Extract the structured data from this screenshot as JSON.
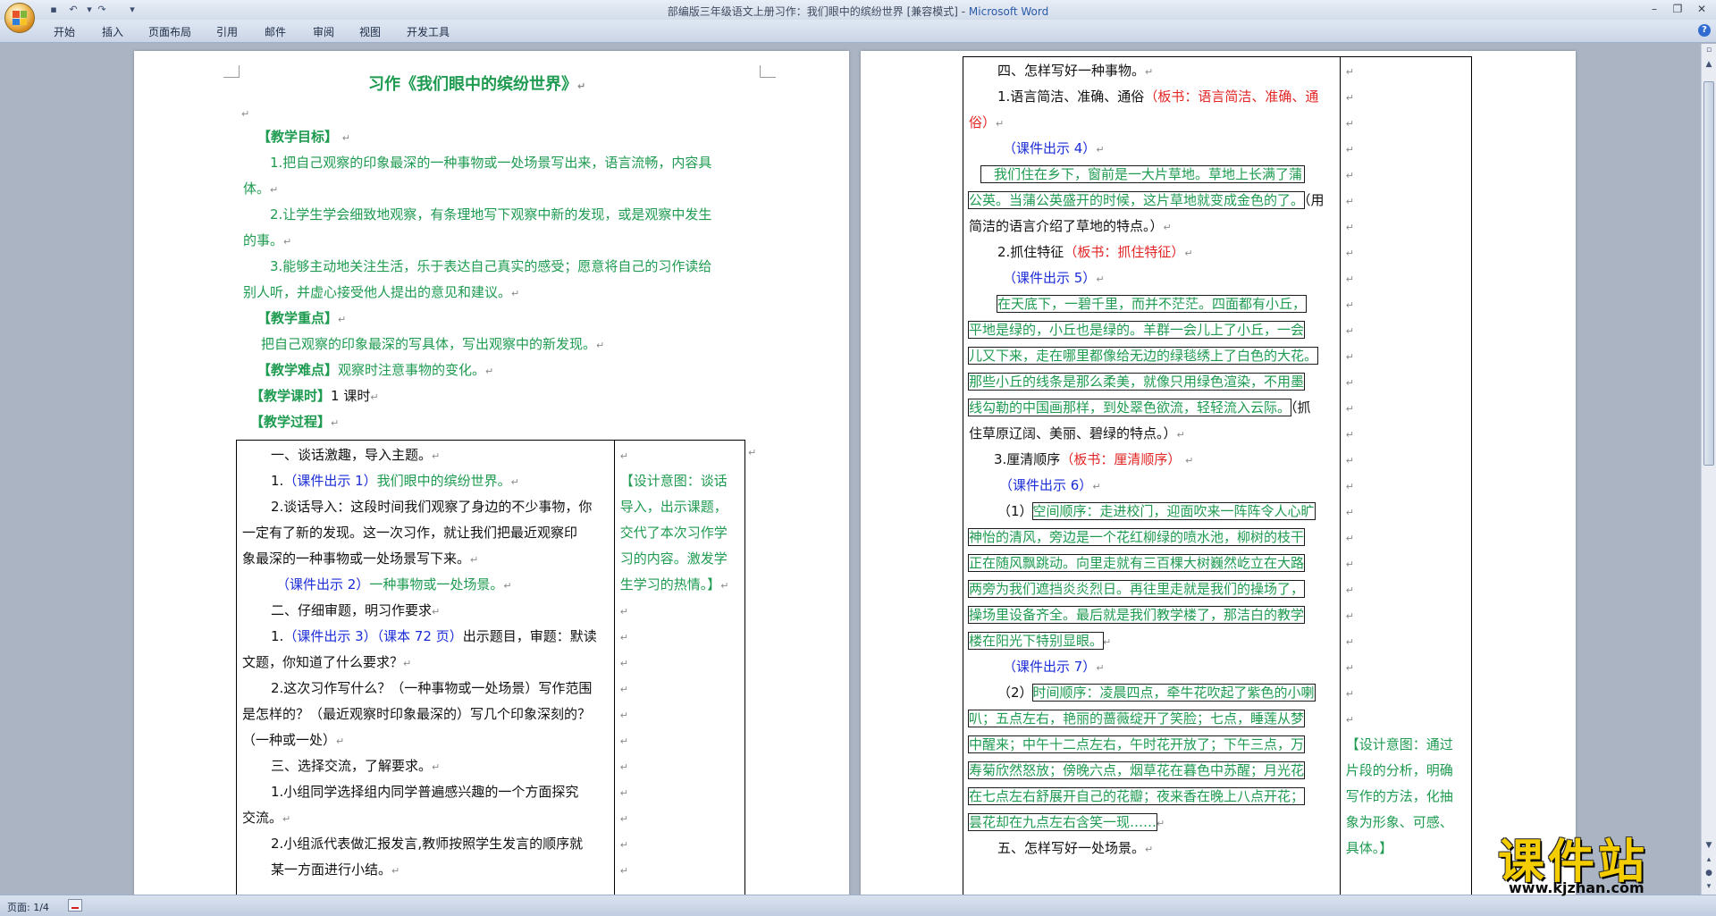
{
  "window": {
    "title": "部编版三年级语文上册习作：我们眼中的缤纷世界 [兼容模式] - ",
    "app_name": "Microsoft Word"
  },
  "quick_access": {
    "save_icon": "save-icon",
    "undo_icon": "undo-icon",
    "redo_icon": "redo-icon",
    "customize_icon": "customize-icon"
  },
  "ribbon": {
    "tabs": [
      "开始",
      "插入",
      "页面布局",
      "引用",
      "邮件",
      "审阅",
      "视图",
      "开发工具"
    ]
  },
  "status": {
    "page": "页面: 1/4"
  },
  "watermark": {
    "title": "课件站",
    "url": "www.kjzhan.com"
  },
  "page1": {
    "title": "习作《我们眼中的缤纷世界》",
    "goal_heading": "【教学目标】",
    "goal1a": "1.把自己观察的印象最深的一种事物或一处场景写出来，语言流畅，内容具",
    "goal1b": "体。",
    "goal2a": "2.让学生学会细致地观察，有条理地写下观察中新的发现，或是观察中发生",
    "goal2b": "的事。",
    "goal3a": "3.能够主动地关注生活，乐于表达自己真实的感受；愿意将自己的习作读给",
    "goal3b": "别人听，并虚心接受他人提出的意见和建议。",
    "key_heading": "【教学重点】",
    "key_text": "把自己观察的印象最深的写具体，写出观察中的新发现。",
    "diff_heading": "【教学难点】",
    "diff_text": "观察时注意事物的变化。",
    "hour_heading": "【教学课时】",
    "hour_text": "1 课时",
    "proc_heading": "【教学过程】",
    "t_l1": "一、谈话激趣，导入主题。",
    "t_l2_num": "1.",
    "t_l2_blue": "（课件出示 1）",
    "t_l2_green": "我们眼中的缤纷世界。",
    "t_l3": "2.谈话导入：这段时间我们观察了身边的不少事物，你",
    "t_l4": "一定有了新的发现。这一次习作，就让我们把最近观察印",
    "t_l5": "象最深的一种事物或一处场景写下来。",
    "t_l6_blue": "（课件出示 2）",
    "t_l6_green": "一种事物或一处场景。",
    "t_l7": "二、仔细审题，明习作要求",
    "t_l8_num": "1.",
    "t_l8_blue": "（课件出示 3）（课本 72 页）",
    "t_l8_rest": "出示题目，审题：默读",
    "t_l9": "文题，你知道了什么要求？",
    "t_l10": "2.这次习作写什么？（一种事物或一处场景）写作范围",
    "t_l11": "是怎样的？（最近观察时印象最深的）写几个印象深刻的？",
    "t_l12": "（一种或一处）",
    "t_l13": "三、选择交流，了解要求。",
    "t_l14": "1.小组同学选择组内同学普遍感兴趣的一个方面探究",
    "t_l15": "交流。",
    "t_l16": "2.小组派代表做汇报发言,教师按照学生发言的顺序就",
    "t_l17": "某一方面进行小结。",
    "side1": "【设计意图：谈话",
    "side2": "导入，出示课题，",
    "side3": "交代了本次习作学",
    "side4": "习的内容。激发学",
    "side5": "生学习的热情。】"
  },
  "page2": {
    "l1": "四、怎样写好一种事物。",
    "l2_black": "1.语言简洁、准确、通俗",
    "l2_red": "（板书：语言简洁、准确、通",
    "l3_red": "俗）",
    "l4_blue": "（课件出示 4）",
    "l5": "我们住在乡下，窗前是一大片草地。草地上长满了蒲",
    "l6_green": "公英。当蒲公英盛开的时候，这片草地就变成金色的了。",
    "l6_black": "（用",
    "l7": "简洁的语言介绍了草地的特点。）",
    "l8_black": "2.抓住特征",
    "l8_red": "（板书：抓住特征）",
    "l9_blue": "（课件出示 5）",
    "l10": "在天底下，一碧千里，而并不茫茫。四面都有小丘，",
    "l11": "平地是绿的，小丘也是绿的。羊群一会儿上了小丘，一会",
    "l12": "儿又下来，走在哪里都像给无边的绿毯绣上了白色的大花。",
    "l13": "那些小丘的线条是那么柔美，就像只用绿色渲染，不用墨",
    "l14_green": "线勾勒的中国画那样，到处翠色欲流，轻轻流入云际。",
    "l14_black": "（抓",
    "l15": "住草原辽阔、美丽、碧绿的特点。）",
    "l16_black": "3.厘清顺序",
    "l16_red": "（板书：厘清顺序）",
    "l17_blue": "（课件出示 6）",
    "l18_black": "（1）",
    "l18_green": "空间顺序：走进校门，迎面吹来一阵阵令人心旷",
    "l19": "神怡的清风，旁边是一个花红柳绿的喷水池，柳树的枝干",
    "l20": "正在随风飘跳动。向里走就有三百棵大树巍然屹立在大路",
    "l21": "两旁为我们遮挡炎炎烈日。再往里走就是我们的操场了，",
    "l22": "操场里设备齐全。最后就是我们教学楼了，那洁白的教学",
    "l23": "楼在阳光下特别显眼。",
    "l24_blue": "（课件出示 7）",
    "l25_black": "（2）",
    "l25_green": "时间顺序：凌晨四点，牵牛花吹起了紫色的小喇",
    "l26": "叭；五点左右，艳丽的蔷薇绽开了笑脸；七点，睡莲从梦",
    "l27": "中醒来；中午十二点左右，午时花开放了；下午三点，万",
    "l28": "寿菊欣然怒放；傍晚六点，烟草花在暮色中苏醒；月光花",
    "l29": "在七点左右舒展开自己的花瓣；夜来香在晚上八点开花；",
    "l30": "昙花却在九点左右含笑一现……",
    "l31": "五、怎样写好一处场景。",
    "side1": "【设计意图：通过",
    "side2": "片段的分析，明确",
    "side3": "写作的方法，化抽",
    "side4": "象为形象、可感、",
    "side5": "具体。】"
  }
}
